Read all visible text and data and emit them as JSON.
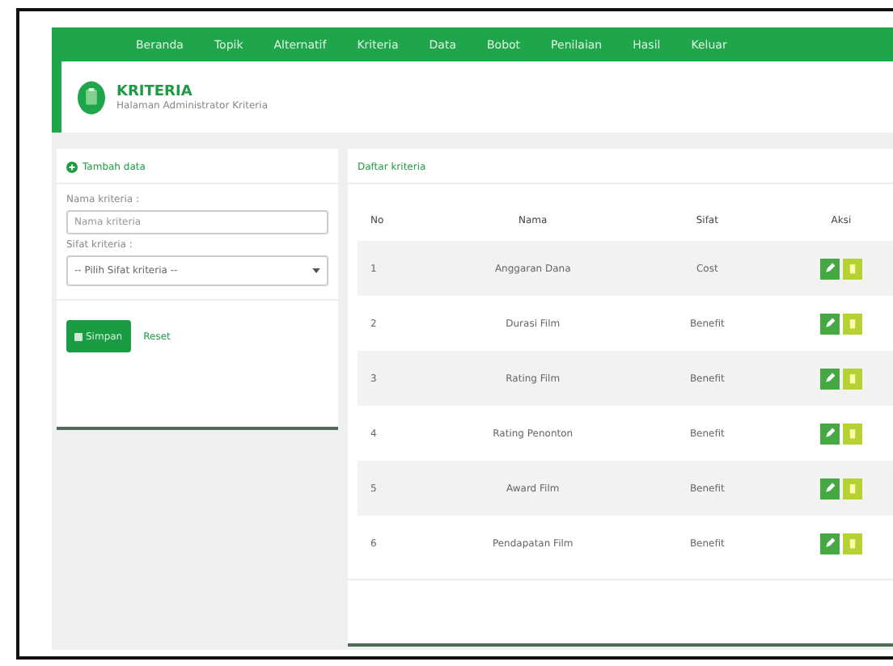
{
  "nav": {
    "items": [
      {
        "label": "Beranda"
      },
      {
        "label": "Topik"
      },
      {
        "label": "Alternatif"
      },
      {
        "label": "Kriteria"
      },
      {
        "label": "Data"
      },
      {
        "label": "Bobot"
      },
      {
        "label": "Penilaian"
      },
      {
        "label": "Hasil"
      },
      {
        "label": "Keluar"
      }
    ]
  },
  "header": {
    "title": "KRITERIA",
    "subtitle": "Halaman Administrator Kriteria"
  },
  "form": {
    "title": "Tambah data",
    "name_label": "Nama kriteria :",
    "name_placeholder": "Nama kriteria",
    "type_label": "Sifat kriteria :",
    "type_value": "-- Pilih Sifat kriteria --",
    "save": "Simpan",
    "reset": "Reset"
  },
  "table": {
    "title": "Daftar kriteria",
    "columns": [
      "No",
      "Nama",
      "Sifat",
      "Aksi"
    ],
    "rows": [
      {
        "no": "1",
        "name": "Anggaran Dana",
        "type": "Cost"
      },
      {
        "no": "2",
        "name": "Durasi Film",
        "type": "Benefit"
      },
      {
        "no": "3",
        "name": "Rating Film",
        "type": "Benefit"
      },
      {
        "no": "4",
        "name": "Rating Penonton",
        "type": "Benefit"
      },
      {
        "no": "5",
        "name": "Award Film",
        "type": "Benefit"
      },
      {
        "no": "6",
        "name": "Pendapatan Film",
        "type": "Benefit"
      }
    ]
  }
}
